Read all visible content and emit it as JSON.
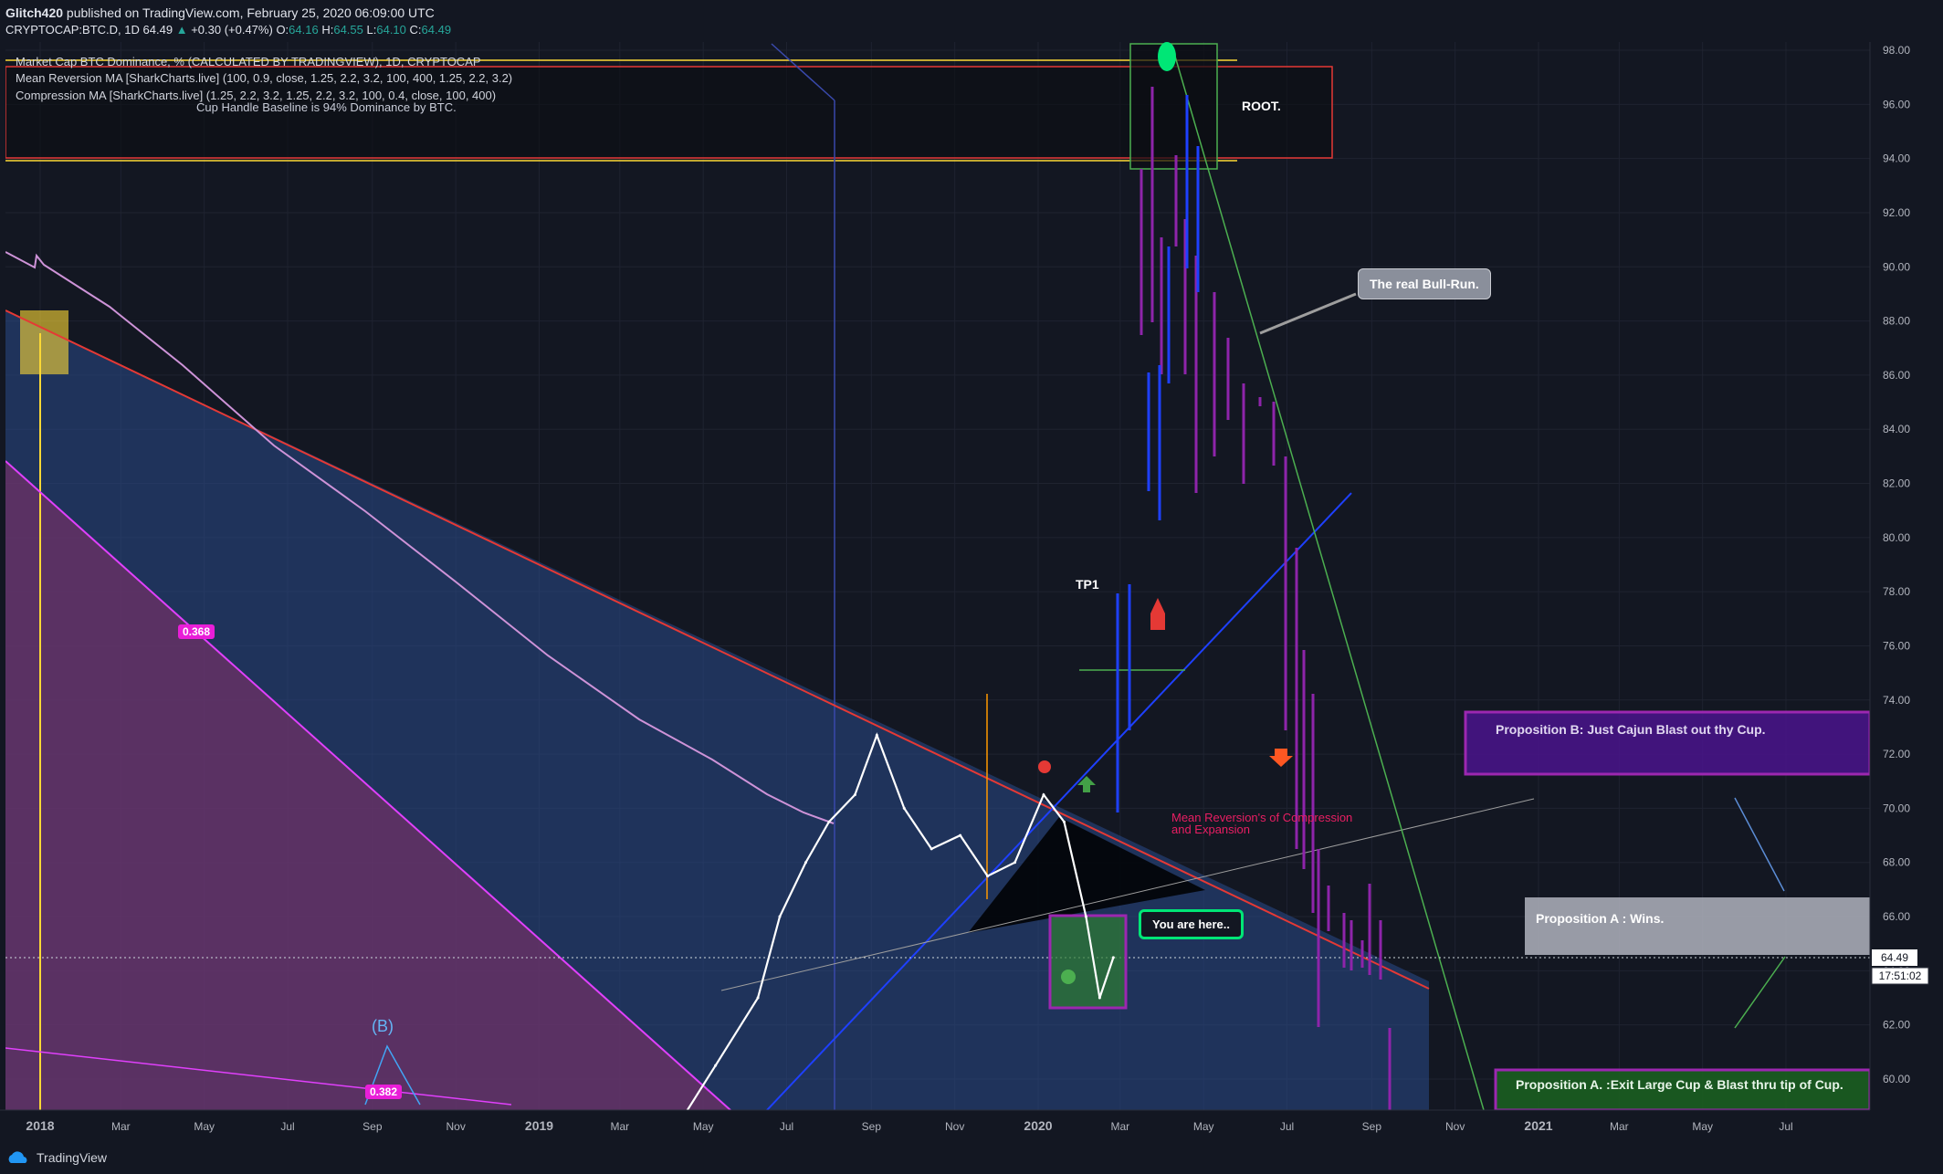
{
  "header": {
    "author": "Glitch420",
    "published": " published on TradingView.com, February 25, 2020 06:09:00 UTC",
    "symbol": "CRYPTOCAP:BTC.D, 1D",
    "last": "64.49",
    "change": "+0.30 (+0.47%)",
    "o_label": "O:",
    "o": "64.16",
    "h_label": "H:",
    "h": "64.55",
    "l_label": "L:",
    "l": "64.10",
    "c_label": "C:",
    "c": "64.49"
  },
  "legend": [
    "Market Cap BTC Dominance, % (CALCULATED BY TRADINGVIEW), 1D, CRYPTOCAP",
    "Mean Reversion MA [SharkCharts.live] (100, 0.9, close, 1.25, 2.2, 3.2, 100, 400, 1.25, 2.2, 3.2)",
    "Compression MA [SharkCharts.live] (1.25, 2.2, 3.2, 1.25, 2.2, 3.2, 100, 0.4, close, 100, 400)"
  ],
  "annotations": {
    "cup_baseline": "Cup Handle Baseline is 94% Dominance by BTC.",
    "root": "ROOT.",
    "bull_run": "The real Bull-Run.",
    "tp1": "TP1",
    "mean_reversion": "Mean Reversion's of Compression",
    "mean_reversion2": "and Expansion",
    "you_are_here": "You are here..",
    "prop_b": "Proposition B: Just Cajun Blast out thy Cup.",
    "prop_a_wins": "Proposition A : Wins.",
    "prop_a_exit": "Proposition A. :Exit Large Cup & Blast thru tip of Cup.",
    "wave_b": "(B)",
    "fib_368": "0.368",
    "fib_382": "0.382"
  },
  "price_tag": "64.49",
  "countdown": "17:51:02",
  "footer": {
    "brand": "TradingView"
  },
  "colors": {
    "background": "#131722",
    "price_line": "#ffffff",
    "resistance": "#e53935",
    "ma_pink": "#e040fb",
    "ma_violet": "#ce93d8",
    "proj_purple": "#8e24aa",
    "proj_blue": "#1e40ff",
    "green_line": "#4caf50",
    "yellow": "#fdd835"
  },
  "chart_data": {
    "type": "line",
    "title": "Market Cap BTC Dominance, % (CALCULATED BY TRADINGVIEW), 1D, CRYPTOCAP",
    "ylim": [
      59,
      98
    ],
    "y_ticks": [
      "98.00",
      "96.00",
      "94.00",
      "92.00",
      "90.00",
      "88.00",
      "86.00",
      "84.00",
      "82.00",
      "80.00",
      "78.00",
      "76.00",
      "74.00",
      "72.00",
      "70.00",
      "68.00",
      "66.00",
      "64.00",
      "62.00",
      "60.00"
    ],
    "x_ticks": [
      "2018",
      "Mar",
      "May",
      "Jul",
      "Sep",
      "Nov",
      "2019",
      "Mar",
      "May",
      "Jul",
      "Sep",
      "Nov",
      "2020",
      "Mar",
      "May",
      "Jul",
      "Sep",
      "Nov",
      "2021",
      "Mar",
      "May",
      "Jul"
    ],
    "series": [
      {
        "name": "",
        "x": [
          "2019-04-15",
          "2019-05-10",
          "2019-06-10",
          "2019-06-26",
          "2019-07-15",
          "2019-08-01",
          "2019-08-20",
          "2019-09-05",
          "2019-09-25",
          "2019-10-15",
          "2019-11-05",
          "2019-11-25",
          "2019-12-15",
          "2020-01-05",
          "2020-01-20",
          "2020-02-05",
          "2020-02-15",
          "2020-02-25"
        ],
        "y": [
          58.5,
          60.5,
          63.0,
          66.0,
          68.0,
          69.5,
          70.5,
          72.7,
          70.0,
          68.5,
          69.0,
          67.5,
          68.0,
          70.5,
          69.5,
          66.0,
          63.0,
          64.49
        ]
      }
    ]
  }
}
